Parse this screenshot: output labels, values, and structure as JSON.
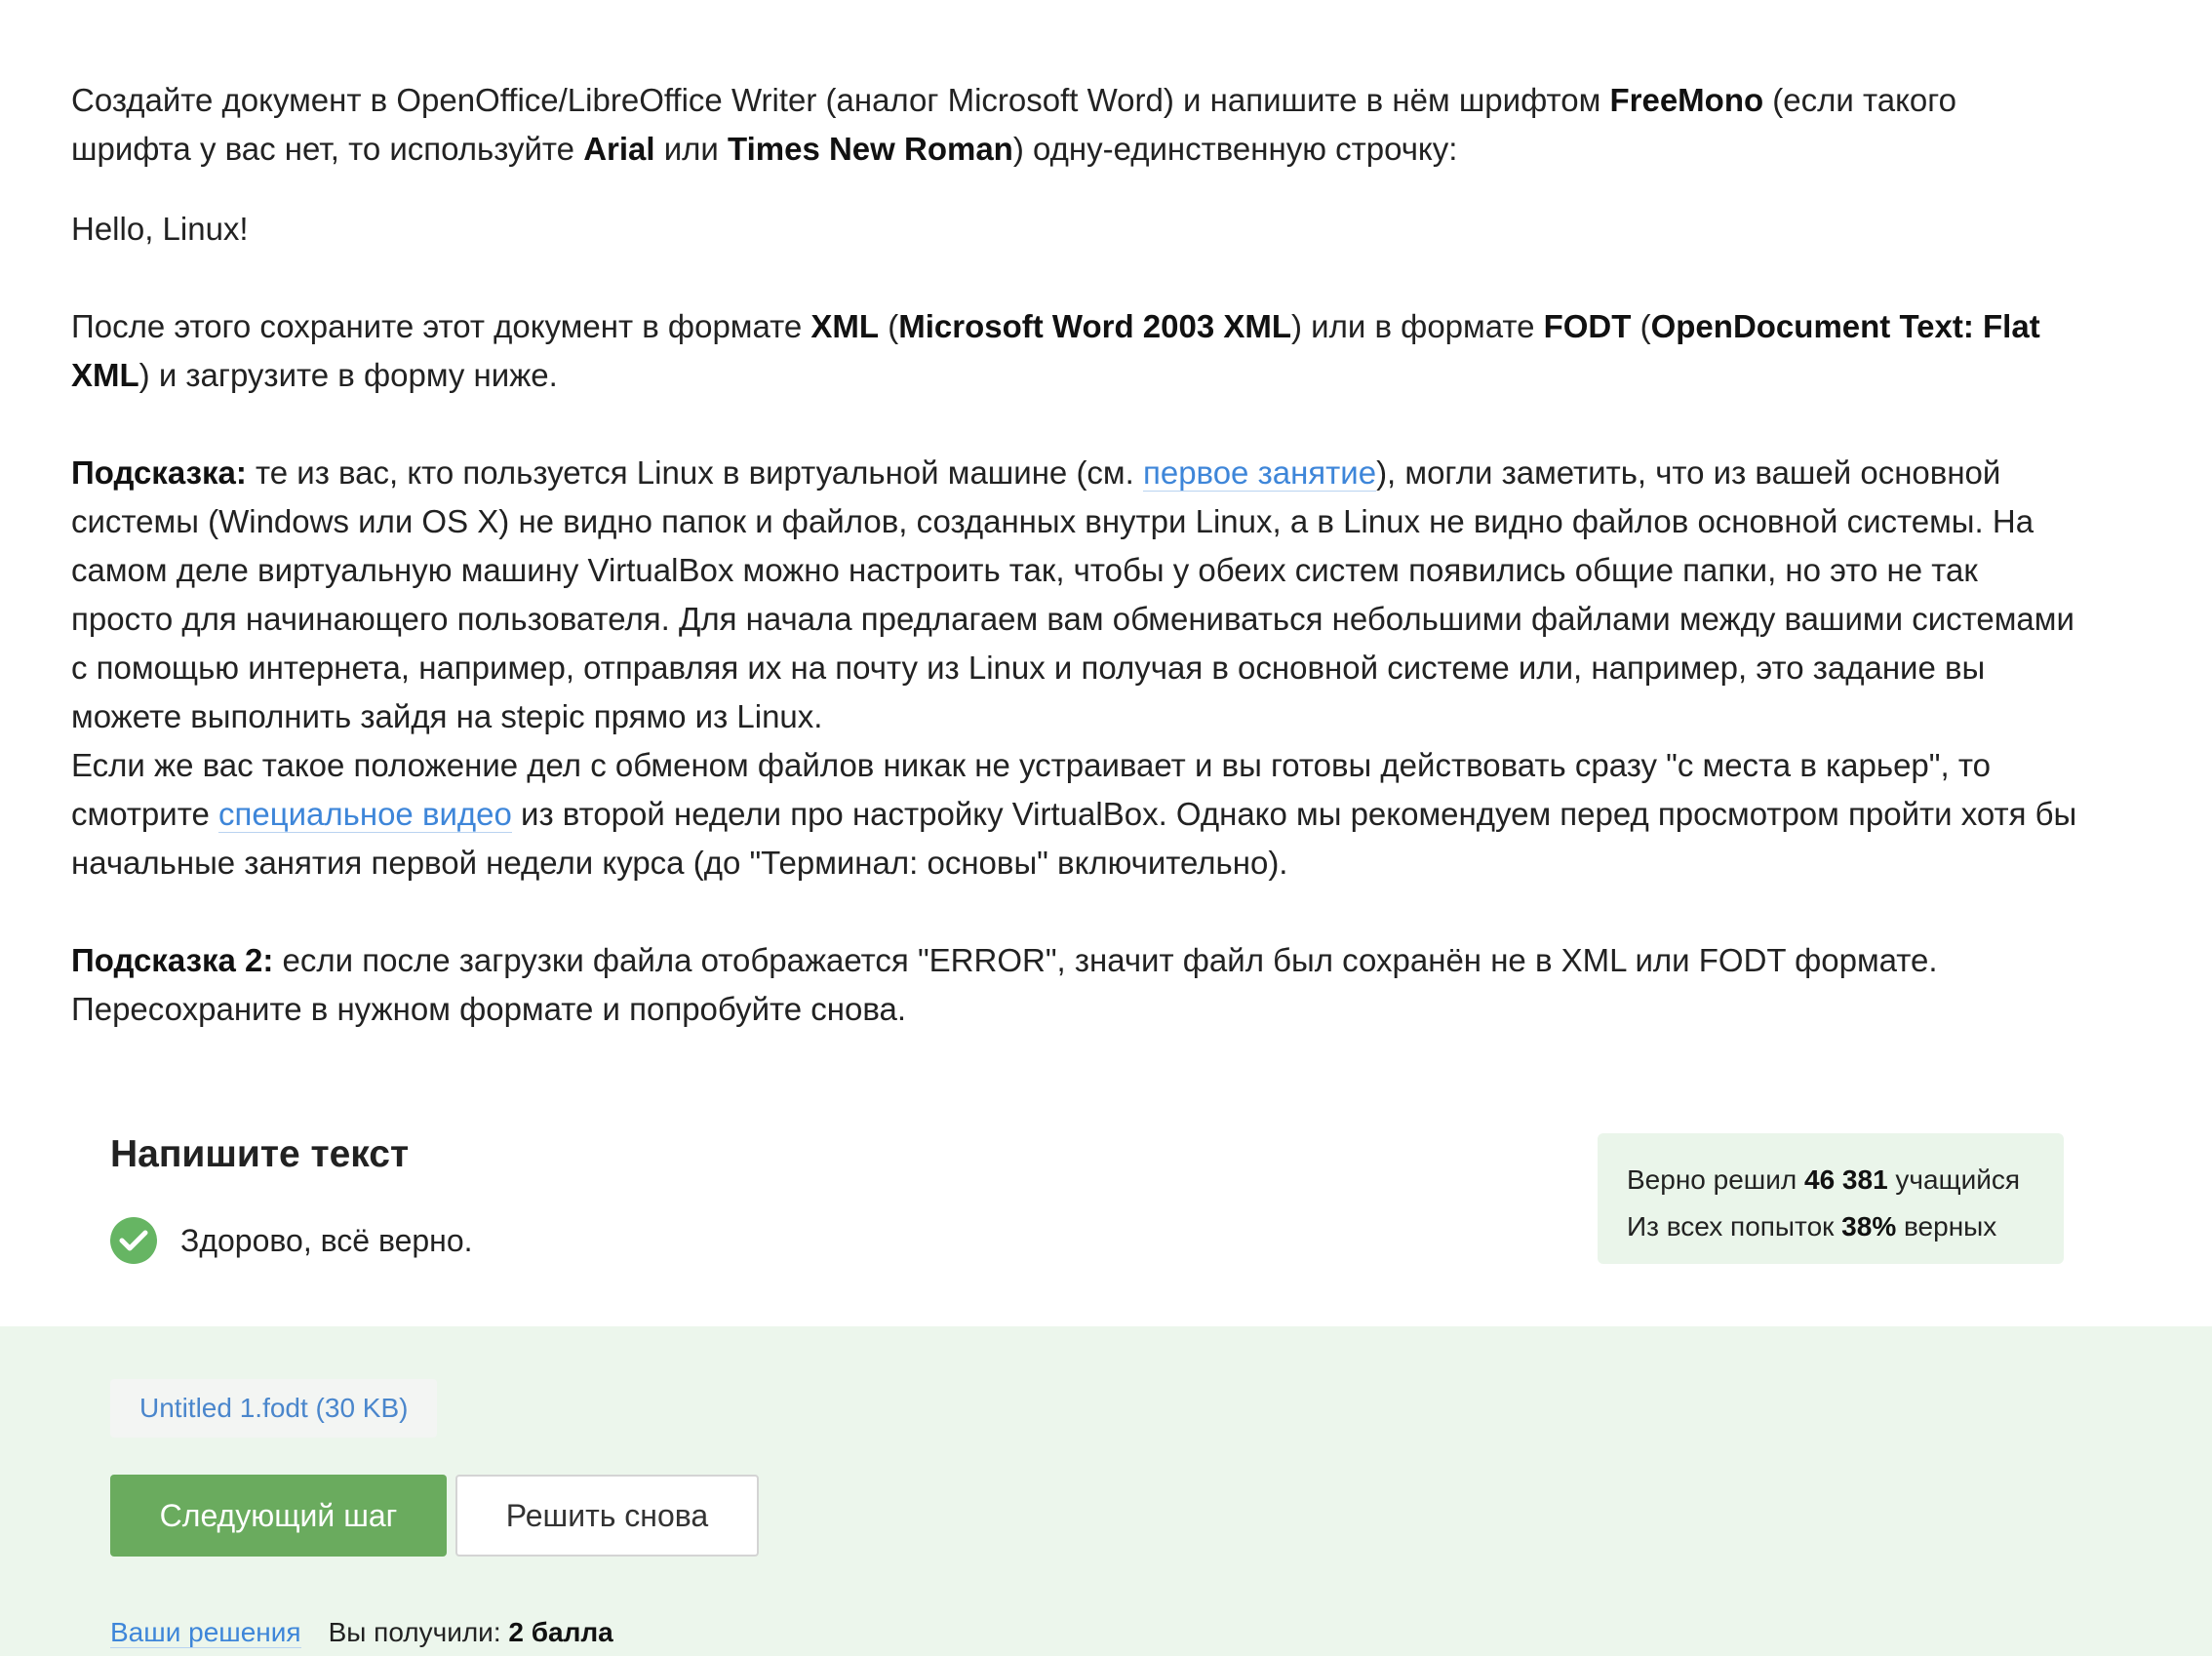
{
  "intro": {
    "t1": "Создайте документ в OpenOffice/LibreOffice Writer (аналог Microsoft Word) и напишите в нём шрифтом ",
    "font_main": "FreeMono",
    "t2": " (если такого шрифта у вас нет, то используйте ",
    "font_alt1": "Arial",
    "t3": " или ",
    "font_alt2": "Times New Roman",
    "t4": ") одну-единственную строчку:"
  },
  "sample_line": "Hello, Linux!",
  "save": {
    "t1": "После этого сохраните этот документ в формате ",
    "fmt1": "XML",
    "t2": " (",
    "fmt1_full": "Microsoft Word 2003 XML",
    "t3": ") или в формате ",
    "fmt2": "FODT",
    "t4": " (",
    "fmt2_full": "OpenDocument Text: Flat XML",
    "t5": ") и загрузите в форму ниже."
  },
  "hint1": {
    "label": "Подсказка:",
    "t1": " те из вас, кто пользуется Linux в виртуальной машине (см. ",
    "link": "первое занятие",
    "t2": "), могли заметить, что из вашей основной системы (Windows или OS X) не видно папок и файлов, созданных внутри Linux, а в Linux не видно файлов основной системы. На самом деле виртуальную машину VirtualBox можно настроить так, чтобы у обеих систем появились общие папки, но это не так просто для начинающего пользователя. Для начала предлагаем вам обмениваться небольшими файлами между вашими системами с помощью интернета, например, отправляя их на почту из Linux и получая в основной системе или, например, это задание вы можете выполнить зайдя на stepic прямо из Linux.",
    "t3": "Если же вас такое положение дел с обменом файлов никак не устраивает и вы готовы действовать сразу \"с места в карьер\", то смотрите ",
    "link2": "специальное видео",
    "t4": " из второй недели про настройку VirtualBox. Однако мы рекомендуем перед просмотром пройти хотя бы начальные занятия первой недели курса (до \"Терминал: основы\" включительно)."
  },
  "hint2": {
    "label": "Подсказка 2:",
    "t1": " если после загрузки файла отображается \"ERROR\", значит файл был сохранён не в XML или FODT формате. Пересохраните в нужном формате и попробуйте снова."
  },
  "task": {
    "title": "Напишите текст",
    "result": "Здорово, всё верно."
  },
  "stats": {
    "solved_prefix": "Верно решил ",
    "solved_count": "46 381",
    "solved_suffix": " учащийся",
    "attempts_prefix": "Из всех попыток ",
    "attempts_pct": "38%",
    "attempts_suffix": " верных"
  },
  "submission": {
    "file": "Untitled 1.fodt (30 KB)",
    "next_label": "Следующий шаг",
    "retry_label": "Решить снова",
    "solutions_link": "Ваши решения",
    "score_prefix": "Вы получили: ",
    "score_value": "2 балла"
  },
  "colors": {
    "link": "#3e86d9",
    "success": "#66b563",
    "next_button": "#6aab5e",
    "submit_bg": "#ecf6ec",
    "stats_bg": "#eaf5ea"
  }
}
